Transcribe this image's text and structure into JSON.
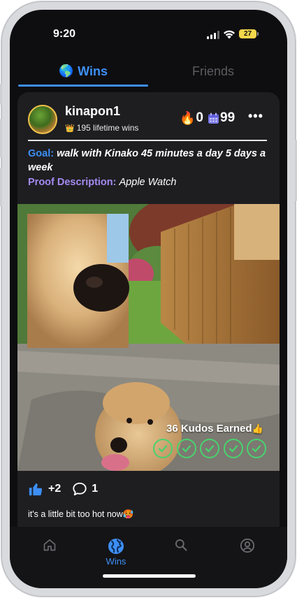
{
  "status_bar": {
    "time": "9:20",
    "battery": "27"
  },
  "tabs": {
    "wins_emoji": "🌎",
    "wins_label": "Wins",
    "friends_label": "Friends"
  },
  "post": {
    "username": "kinapon1",
    "crown_emoji": "👑",
    "lifetime_wins": "195 lifetime wins",
    "fire_emoji": "🔥",
    "streak_count": "0",
    "calendar_count": "99",
    "more": "•••",
    "goal_label": "Goal:",
    "goal_text": "walk with Kinako 45 minutes a day 5 days a week",
    "proof_label": "Proof Description:",
    "proof_text": "Apple Watch",
    "kudos_text": "36 Kudos Earned",
    "kudos_emoji": "👍",
    "check_count": 5,
    "like_count": "+2",
    "comment_count": "1",
    "caption": "it's a little bit too hot now🥵"
  },
  "bottom_nav": {
    "wins_label": "Wins"
  },
  "colors": {
    "accent": "#3d8ff5",
    "purple": "#a58af0",
    "check": "#49d26e",
    "background": "#0e0e10",
    "card": "#1e1e21"
  },
  "icons": [
    "signal-icon",
    "wifi-icon",
    "battery-icon",
    "globe-icon",
    "fire-icon",
    "calendar-icon",
    "more-icon",
    "check-icon",
    "thumbs-up-icon",
    "comment-icon",
    "home-icon",
    "search-icon",
    "profile-icon"
  ]
}
